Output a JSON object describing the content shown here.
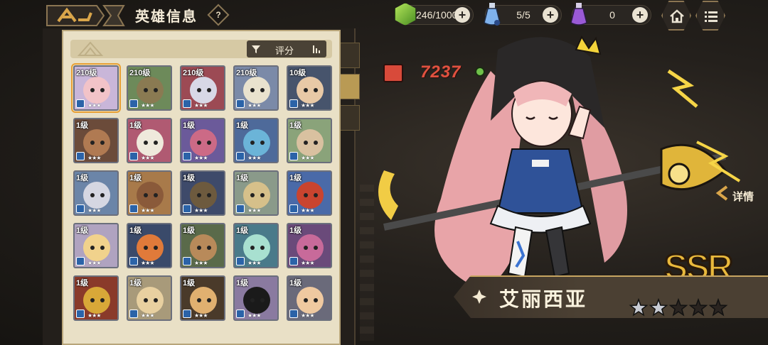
{
  "header": {
    "title": "英雄信息",
    "help_icon": "question-icon",
    "home_icon": "home-icon",
    "menu_icon": "list-menu-icon"
  },
  "resources": {
    "energy": {
      "value": "246/1000",
      "icon": "green-gem-icon"
    },
    "potion_blue": {
      "value": "5/5",
      "icon": "blue-potion-icon"
    },
    "potion_purple": {
      "value": "0",
      "icon": "purple-potion-icon"
    }
  },
  "filter": {
    "sort_label": "评分"
  },
  "heroes": [
    {
      "level": "210级",
      "color": "#f2c3c8",
      "bg": "#c9b6d9",
      "selected": true,
      "stars": "★★★"
    },
    {
      "level": "210级",
      "color": "#8a7a52",
      "bg": "#6d8a5a",
      "stars": "★★★"
    },
    {
      "level": "210级",
      "color": "#d8d8e6",
      "bg": "#9c4a54",
      "stars": "★★★"
    },
    {
      "level": "210级",
      "color": "#e9e2ce",
      "bg": "#7b8aa8",
      "stars": "★★★"
    },
    {
      "level": "10级",
      "color": "#e8c9a6",
      "bg": "#47546c",
      "stars": "★★★"
    },
    {
      "level": "1级",
      "color": "#b07a52",
      "bg": "#6b4b3a",
      "stars": "★★★"
    },
    {
      "level": "1级",
      "color": "#efe9dc",
      "bg": "#b05a72",
      "stars": "★★★"
    },
    {
      "level": "1级",
      "color": "#cc6a86",
      "bg": "#6b5a9a",
      "stars": "★★★"
    },
    {
      "level": "1级",
      "color": "#6bb4d8",
      "bg": "#4e6a9a",
      "stars": "★★★"
    },
    {
      "level": "1级",
      "color": "#d9c1a0",
      "bg": "#8aa37a",
      "stars": "★★★"
    },
    {
      "level": "1级",
      "color": "#d5d7e2",
      "bg": "#6b85a8",
      "stars": "★★★"
    },
    {
      "level": "1级",
      "color": "#8a5a3a",
      "bg": "#a87a4a",
      "stars": "★★★"
    },
    {
      "level": "1级",
      "color": "#6d5a3e",
      "bg": "#3e4a6a",
      "stars": "★★★"
    },
    {
      "level": "1级",
      "color": "#d6c08a",
      "bg": "#8a9a8a",
      "stars": "★★★"
    },
    {
      "level": "1级",
      "color": "#c9442f",
      "bg": "#4a6aa8",
      "stars": "★★★"
    },
    {
      "level": "1级",
      "color": "#f1d28c",
      "bg": "#b0a3c0",
      "stars": "★★★"
    },
    {
      "level": "1级",
      "color": "#e07a3a",
      "bg": "#3a4a6a",
      "stars": "★★★"
    },
    {
      "level": "1级",
      "color": "#b88a5a",
      "bg": "#5a6a4a",
      "stars": "★★★"
    },
    {
      "level": "1级",
      "color": "#a8e0d0",
      "bg": "#4a7a8a",
      "stars": "★★★"
    },
    {
      "level": "1级",
      "color": "#c86a9a",
      "bg": "#6a4a7a",
      "stars": "★★★"
    },
    {
      "level": "1级",
      "color": "#d8a838",
      "bg": "#8a3a2a",
      "stars": "★★★"
    },
    {
      "level": "1级",
      "color": "#e8d0a0",
      "bg": "#a89a7a",
      "stars": "★★★"
    },
    {
      "level": "1级",
      "color": "#e0b070",
      "bg": "#4a3a2a",
      "stars": "★★★"
    },
    {
      "level": "1级",
      "color": "#1a1a1a",
      "bg": "#8a7aa0",
      "stars": "★★★"
    },
    {
      "level": "1级",
      "color": "#efc9a0",
      "bg": "#6a6a7a",
      "stars": "★★★"
    }
  ],
  "hero": {
    "power": "7237",
    "name": "艾丽西亚",
    "rarity": "SSR",
    "detail_label": "详情",
    "stars_filled": 2,
    "stars_total": 5
  },
  "colors": {
    "accent_gold": "#c7a561",
    "power_red": "#e0513f",
    "panel_cream": "#e9e0c6"
  }
}
